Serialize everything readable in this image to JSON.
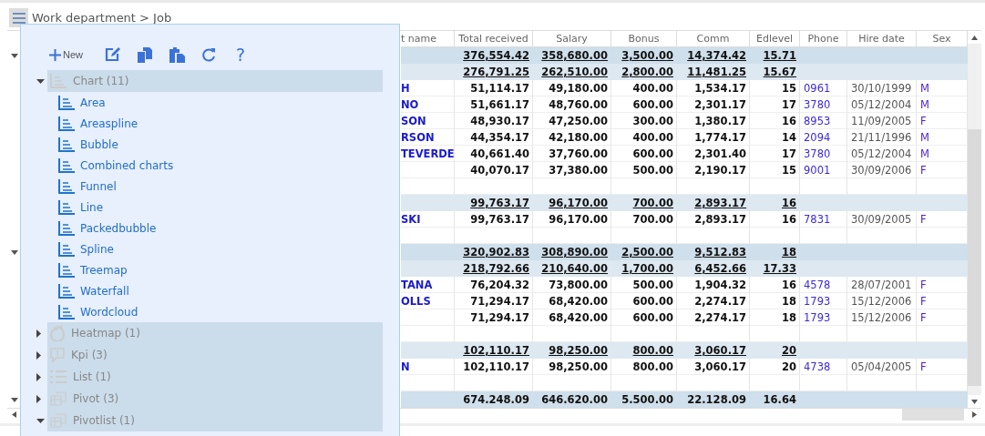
{
  "breadcrumb": "Work department > Job",
  "grid": {
    "columns": [
      "t name",
      "Total received",
      "Salary",
      "Bonus",
      "Comm",
      "Edlevel",
      "Phone",
      "Hire date",
      "Sex"
    ],
    "rows": [
      {
        "kind": "group1",
        "expanded": true,
        "total_received": "376,554.42",
        "salary": "358,680.00",
        "bonus": "3,500.00",
        "comm": "14,374.42",
        "edlevel": "15.71"
      },
      {
        "kind": "group2",
        "total_received": "276,791.25",
        "salary": "262,510.00",
        "bonus": "2,800.00",
        "comm": "11,481.25",
        "edlevel": "15.67"
      },
      {
        "kind": "data",
        "name": "H",
        "total_received": "51,114.17",
        "salary": "49,180.00",
        "bonus": "400.00",
        "comm": "1,534.17",
        "edlevel": "15",
        "phone": "0961",
        "hire_date": "30/10/1999",
        "sex": "M"
      },
      {
        "kind": "data",
        "name": "NO",
        "total_received": "51,661.17",
        "salary": "48,760.00",
        "bonus": "600.00",
        "comm": "2,301.17",
        "edlevel": "17",
        "phone": "3780",
        "hire_date": "05/12/2004",
        "sex": "M"
      },
      {
        "kind": "data",
        "name": "SON",
        "total_received": "48,930.17",
        "salary": "47,250.00",
        "bonus": "300.00",
        "comm": "1,380.17",
        "edlevel": "16",
        "phone": "8953",
        "hire_date": "11/09/2005",
        "sex": "F"
      },
      {
        "kind": "data",
        "name": "RSON",
        "total_received": "44,354.17",
        "salary": "42,180.00",
        "bonus": "400.00",
        "comm": "1,774.17",
        "edlevel": "14",
        "phone": "2094",
        "hire_date": "21/11/1996",
        "sex": "M"
      },
      {
        "kind": "data",
        "name": "TEVERDE",
        "total_received": "40,661.40",
        "salary": "37,760.00",
        "bonus": "600.00",
        "comm": "2,301.40",
        "edlevel": "17",
        "phone": "3780",
        "hire_date": "05/12/2004",
        "sex": "M"
      },
      {
        "kind": "data",
        "total_received": "40,070.17",
        "salary": "37,380.00",
        "bonus": "500.00",
        "comm": "2,190.17",
        "edlevel": "15",
        "phone": "9001",
        "hire_date": "30/09/2006",
        "sex": "F"
      },
      {
        "kind": "blank"
      },
      {
        "kind": "group2",
        "total_received": "99,763.17",
        "salary": "96,170.00",
        "bonus": "700.00",
        "comm": "2,893.17",
        "edlevel": "16"
      },
      {
        "kind": "data",
        "name": "SKI",
        "total_received": "99,763.17",
        "salary": "96,170.00",
        "bonus": "700.00",
        "comm": "2,893.17",
        "edlevel": "16",
        "phone": "7831",
        "hire_date": "30/09/2005",
        "sex": "F"
      },
      {
        "kind": "blank"
      },
      {
        "kind": "group1",
        "expanded": true,
        "total_received": "320,902.83",
        "salary": "308,890.00",
        "bonus": "2,500.00",
        "comm": "9,512.83",
        "edlevel": "18"
      },
      {
        "kind": "group2",
        "total_received": "218,792.66",
        "salary": "210,640.00",
        "bonus": "1,700.00",
        "comm": "6,452.66",
        "edlevel": "17.33"
      },
      {
        "kind": "data",
        "name": "TANA",
        "total_received": "76,204.32",
        "salary": "73,800.00",
        "bonus": "500.00",
        "comm": "1,904.32",
        "edlevel": "16",
        "phone": "4578",
        "hire_date": "28/07/2001",
        "sex": "F"
      },
      {
        "kind": "data",
        "name": "OLLS",
        "total_received": "71,294.17",
        "salary": "68,420.00",
        "bonus": "600.00",
        "comm": "2,274.17",
        "edlevel": "18",
        "phone": "1793",
        "hire_date": "15/12/2006",
        "sex": "F"
      },
      {
        "kind": "data",
        "total_received": "71,294.17",
        "salary": "68,420.00",
        "bonus": "600.00",
        "comm": "2,274.17",
        "edlevel": "18",
        "phone": "1793",
        "hire_date": "15/12/2006",
        "sex": "F"
      },
      {
        "kind": "blank"
      },
      {
        "kind": "group2",
        "total_received": "102,110.17",
        "salary": "98,250.00",
        "bonus": "800.00",
        "comm": "3,060.17",
        "edlevel": "20"
      },
      {
        "kind": "data",
        "name": "N",
        "total_received": "102,110.17",
        "salary": "98,250.00",
        "bonus": "800.00",
        "comm": "3,060.17",
        "edlevel": "20",
        "phone": "4738",
        "hire_date": "05/04/2005",
        "sex": "F"
      },
      {
        "kind": "blank"
      },
      {
        "kind": "total",
        "expanded": true,
        "total_received": "674.248.09",
        "salary": "646.620.00",
        "bonus": "5.500.00",
        "comm": "22.128.09",
        "edlevel": "16.64"
      }
    ]
  },
  "panel": {
    "toolbar": [
      {
        "kind": "new",
        "label": "New"
      },
      {
        "kind": "edit"
      },
      {
        "kind": "copy"
      },
      {
        "kind": "paste"
      },
      {
        "kind": "refresh"
      },
      {
        "kind": "help",
        "label": "?"
      }
    ],
    "tree": [
      {
        "kind": "chart",
        "label": "Chart (11)",
        "expanded": true,
        "children": [
          {
            "label": "Area"
          },
          {
            "label": "Areaspline"
          },
          {
            "label": "Bubble"
          },
          {
            "label": "Combined charts"
          },
          {
            "label": "Funnel"
          },
          {
            "label": "Line"
          },
          {
            "label": "Packedbubble"
          },
          {
            "label": "Spline"
          },
          {
            "label": "Treemap"
          },
          {
            "label": "Waterfall"
          },
          {
            "label": "Wordcloud"
          }
        ]
      },
      {
        "kind": "heatmap",
        "label": "Heatmap (1)",
        "expanded": false
      },
      {
        "kind": "kpi",
        "label": "Kpi (3)",
        "expanded": false
      },
      {
        "kind": "list",
        "label": "List (1)",
        "expanded": false
      },
      {
        "kind": "pivot",
        "label": "Pivot (3)",
        "expanded": false
      },
      {
        "kind": "pivot",
        "label": "Pivotlist (1)",
        "expanded": true
      }
    ]
  }
}
